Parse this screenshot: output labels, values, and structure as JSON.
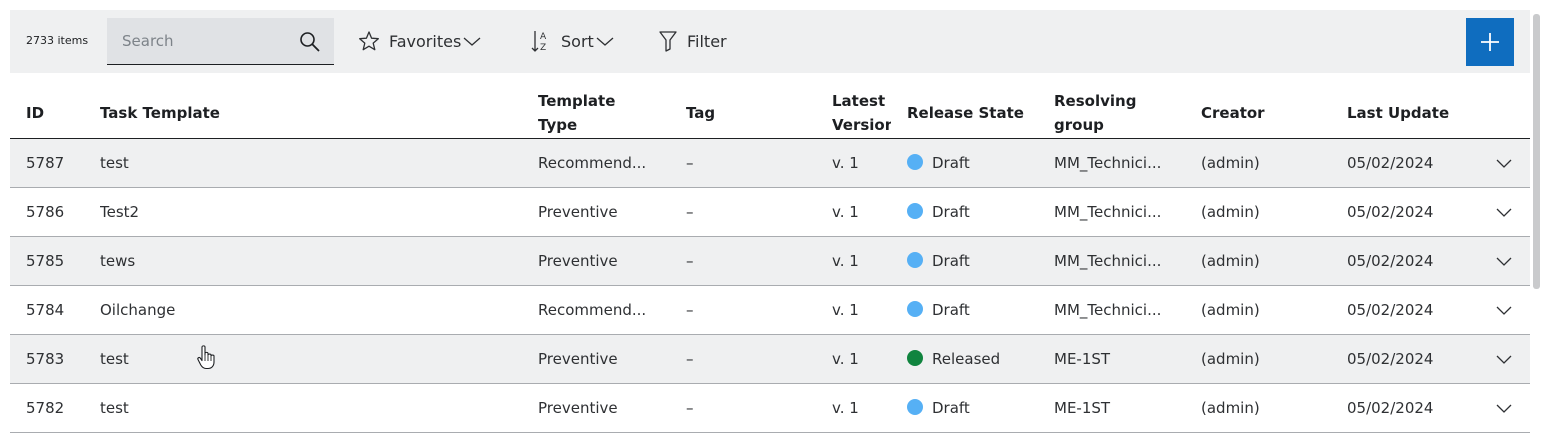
{
  "toolbar": {
    "item_count": "2733 items",
    "search_placeholder": "Search",
    "favorites_label": "Favorites",
    "sort_label": "Sort",
    "filter_label": "Filter"
  },
  "columns": {
    "id": "ID",
    "task_template": "Task Template",
    "template_type_1": "Template",
    "template_type_2": "Type",
    "tag": "Tag",
    "latest_version_1": "Latest",
    "latest_version_2": "Version",
    "release_state": "Release State",
    "resolving_group_1": "Resolving",
    "resolving_group_2": "group",
    "creator": "Creator",
    "last_update": "Last Update"
  },
  "rows": [
    {
      "id": "5787",
      "name": "test",
      "type": "Recommend...",
      "tag": "–",
      "version": "v. 1",
      "state": "Draft",
      "state_color": "#56b0f5",
      "group": "MM_Technici...",
      "creator": "(admin)",
      "updated": "05/02/2024"
    },
    {
      "id": "5786",
      "name": "Test2",
      "type": "Preventive",
      "tag": "–",
      "version": "v. 1",
      "state": "Draft",
      "state_color": "#56b0f5",
      "group": "MM_Technici...",
      "creator": "(admin)",
      "updated": "05/02/2024"
    },
    {
      "id": "5785",
      "name": "tews",
      "type": "Preventive",
      "tag": "–",
      "version": "v. 1",
      "state": "Draft",
      "state_color": "#56b0f5",
      "group": "MM_Technici...",
      "creator": "(admin)",
      "updated": "05/02/2024"
    },
    {
      "id": "5784",
      "name": "Oilchange",
      "type": "Recommend...",
      "tag": "–",
      "version": "v. 1",
      "state": "Draft",
      "state_color": "#56b0f5",
      "group": "MM_Technici...",
      "creator": "(admin)",
      "updated": "05/02/2024"
    },
    {
      "id": "5783",
      "name": "test",
      "type": "Preventive",
      "tag": "–",
      "version": "v. 1",
      "state": "Released",
      "state_color": "#10843f",
      "group": "ME-1ST",
      "creator": "(admin)",
      "updated": "05/02/2024"
    },
    {
      "id": "5782",
      "name": "test",
      "type": "Preventive",
      "tag": "–",
      "version": "v. 1",
      "state": "Draft",
      "state_color": "#56b0f5",
      "group": "ME-1ST",
      "creator": "(admin)",
      "updated": "05/02/2024"
    }
  ],
  "colors": {
    "accent": "#0f6dbf",
    "toolbar_bg": "#eff0f1",
    "draft": "#56b0f5",
    "released": "#10843f"
  },
  "icons": {
    "search": "search-icon",
    "favorites": "star-icon",
    "sort": "sort-icon",
    "filter": "filter-icon",
    "add": "plus-icon",
    "expand": "chevron-down-icon"
  }
}
